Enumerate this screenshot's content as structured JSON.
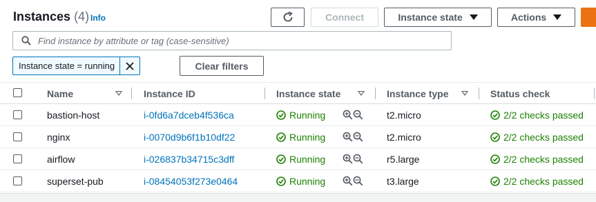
{
  "header": {
    "title": "Instances",
    "count": "(4)",
    "info_label": "Info"
  },
  "toolbar": {
    "refresh_icon": "refresh-icon",
    "connect_label": "Connect",
    "instance_state_label": "Instance state",
    "actions_label": "Actions"
  },
  "search": {
    "placeholder": "Find instance by attribute or tag (case-sensitive)",
    "value": ""
  },
  "filter": {
    "token_label": "Instance state = running",
    "clear_label": "Clear filters"
  },
  "table": {
    "columns": [
      "Name",
      "Instance ID",
      "Instance state",
      "Instance type",
      "Status check"
    ],
    "rows": [
      {
        "name": "bastion-host",
        "id": "i-0fd6a7dceb4f536ca",
        "state": "Running",
        "type": "t2.micro",
        "status": "2/2 checks passed"
      },
      {
        "name": "nginx",
        "id": "i-0070d9b6f1b10df22",
        "state": "Running",
        "type": "t2.micro",
        "status": "2/2 checks passed"
      },
      {
        "name": "airflow",
        "id": "i-026837b34715c3dff",
        "state": "Running",
        "type": "r5.large",
        "status": "2/2 checks passed"
      },
      {
        "name": "superset-pub",
        "id": "i-08454053f273e0464",
        "state": "Running",
        "type": "t3.large",
        "status": "2/2 checks passed"
      }
    ]
  },
  "colors": {
    "link": "#0073bb",
    "success": "#1d8102",
    "primary": "#ec7211"
  }
}
